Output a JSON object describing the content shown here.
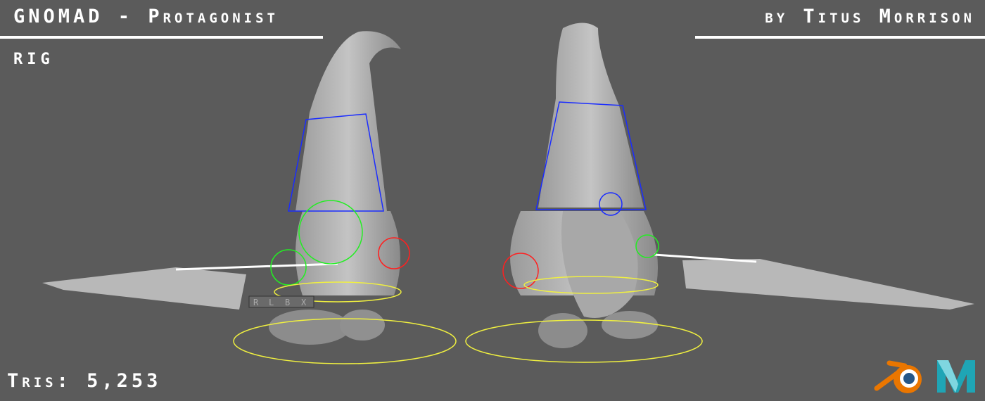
{
  "header": {
    "title_left": "GNOMAD - ",
    "title_right": "Protagonist",
    "author": "by Titus Morrison",
    "subtitle": "RIG"
  },
  "stats": {
    "tris": "Tris: 5,253"
  },
  "rig_labels": [
    "R",
    "L",
    "B",
    "X"
  ],
  "logos": [
    "blender-logo",
    "maya-logo"
  ],
  "colors": {
    "background": "#5b5b5b",
    "mesh": "#b4b4b4",
    "rig_blue": "#1a2cff",
    "rig_green": "#22ee22",
    "rig_red": "#ff2020",
    "rig_yellow": "#f0f040"
  }
}
